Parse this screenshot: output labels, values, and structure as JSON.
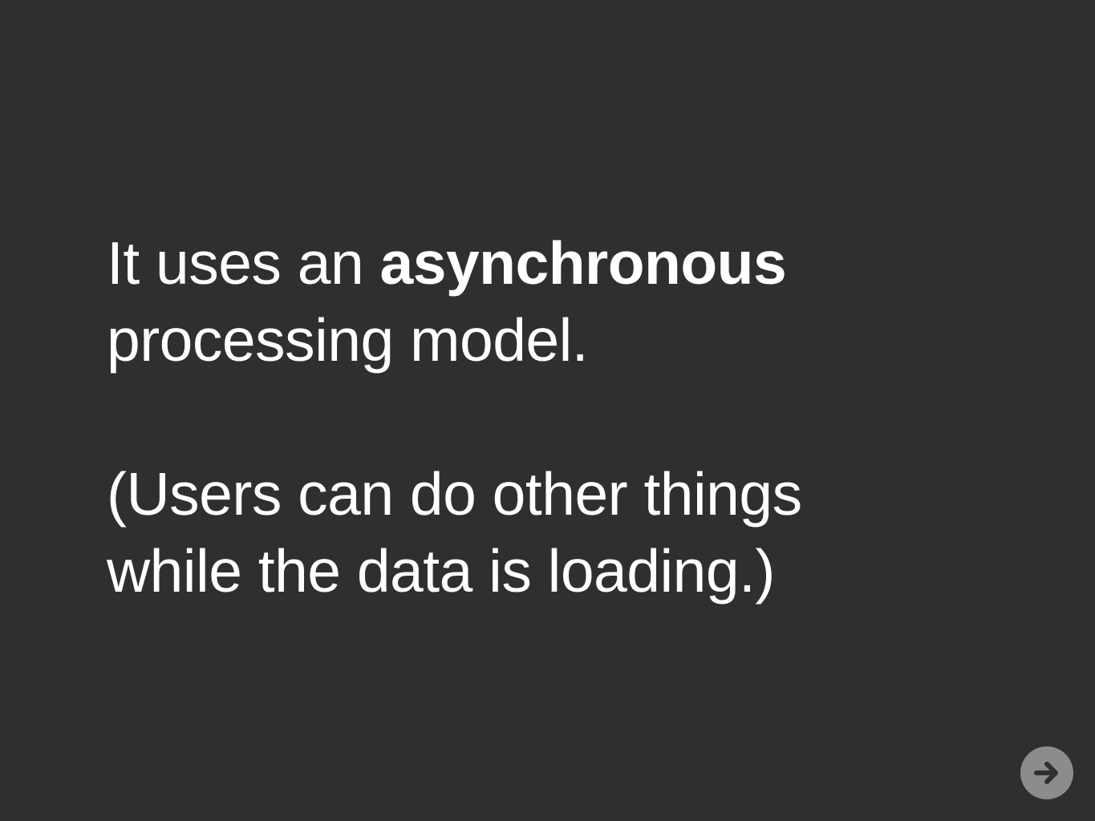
{
  "slide": {
    "paragraph1": {
      "part1": "It uses an ",
      "bold": "asynchronous",
      "line2": "processing model."
    },
    "paragraph2": {
      "line1": "(Users can do other things",
      "line2": "while the data is loading.)"
    }
  },
  "navigation": {
    "next_icon": "arrow-right-icon"
  },
  "colors": {
    "background": "#312f2d",
    "text": "#ffffff",
    "nav_button": "#8e8c8b",
    "nav_arrow": "#312f2d"
  }
}
